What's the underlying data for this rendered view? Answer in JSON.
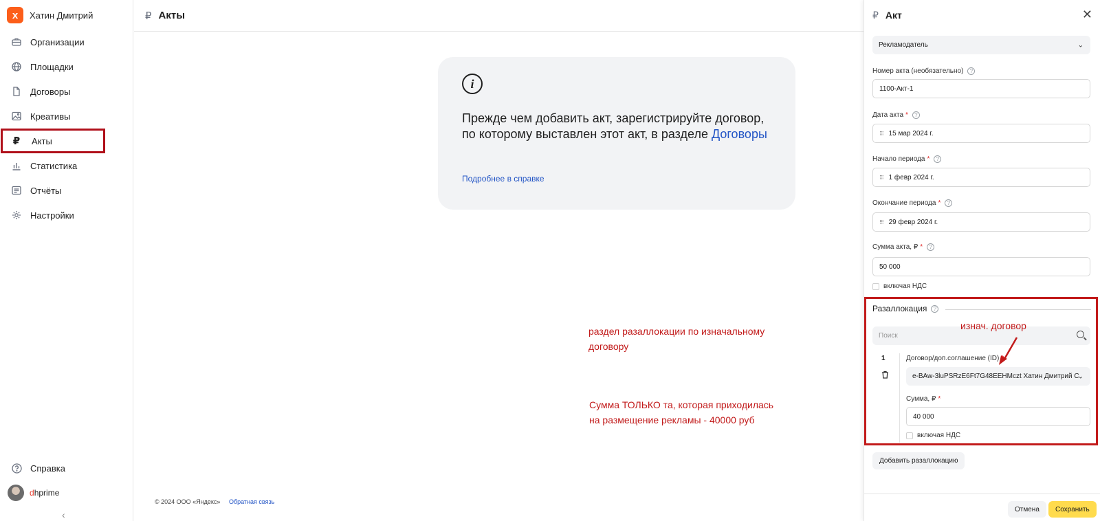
{
  "user": {
    "logo": "x",
    "name": "Хатин Дмитрий"
  },
  "nav": [
    {
      "label": "Организации",
      "icon": "briefcase-icon"
    },
    {
      "label": "Площадки",
      "icon": "globe-icon"
    },
    {
      "label": "Договоры",
      "icon": "document-icon"
    },
    {
      "label": "Креативы",
      "icon": "image-icon"
    },
    {
      "label": "Акты",
      "icon": "ruble-icon"
    },
    {
      "label": "Статистика",
      "icon": "bar-chart-icon"
    },
    {
      "label": "Отчёты",
      "icon": "report-icon"
    },
    {
      "label": "Настройки",
      "icon": "gear-icon"
    }
  ],
  "bottom": {
    "help": "Справка",
    "account": {
      "prefix": "d",
      "rest": "hprime"
    }
  },
  "main": {
    "title": "Акты",
    "card": {
      "text": "Прежде чем добавить акт, зарегистрируйте договор, по которому выставлен этот акт, в разделе",
      "link": "Договоры",
      "help_link": "Подробнее в справке"
    },
    "annotation1": [
      "раздел разаллокации по изначальному",
      "договору"
    ],
    "annotation2": [
      "Сумма ТОЛЬКО та, которая приходилась",
      "на размещение рекламы - 40000 руб"
    ],
    "footer": {
      "copyright": "© 2024 ООО «Яндекс»",
      "feedback": "Обратная связь"
    }
  },
  "panel": {
    "title": "Акт",
    "role": "Рекламодатель",
    "act_number": {
      "label": "Номер акта (необязательно)",
      "value": "1100-Акт-1"
    },
    "act_date": {
      "label": "Дата акта",
      "value": "15 мар 2024 г."
    },
    "period_start": {
      "label": "Начало периода",
      "value": "1 февр 2024 г."
    },
    "period_end": {
      "label": "Окончание периода",
      "value": "29 февр 2024 г."
    },
    "amount": {
      "label": "Сумма акта, ₽",
      "value": "50 000"
    },
    "vat": "включая НДС",
    "realloc": {
      "title": "Разаллокация",
      "search_placeholder": "Поиск",
      "annotation": "изнач. договор",
      "row_number": "1",
      "contract_label": "Договор/доп.соглашение (ID)",
      "contract_value": "e-BAw-3luPSRzE6Ft7G48EEHMczt Хатин Дмитрий С",
      "sum_label": "Сумма, ₽",
      "sum_value": "40 000",
      "vat": "включая НДС"
    },
    "add_button": "Добавить разаллокацию",
    "cancel": "Отмена",
    "save": "Сохранить"
  },
  "colors": {
    "accent_yellow": "#ffdb4d",
    "annotation_red": "#c21b1b",
    "link_blue": "#2254c5",
    "logo_orange": "#fc5e1a"
  }
}
